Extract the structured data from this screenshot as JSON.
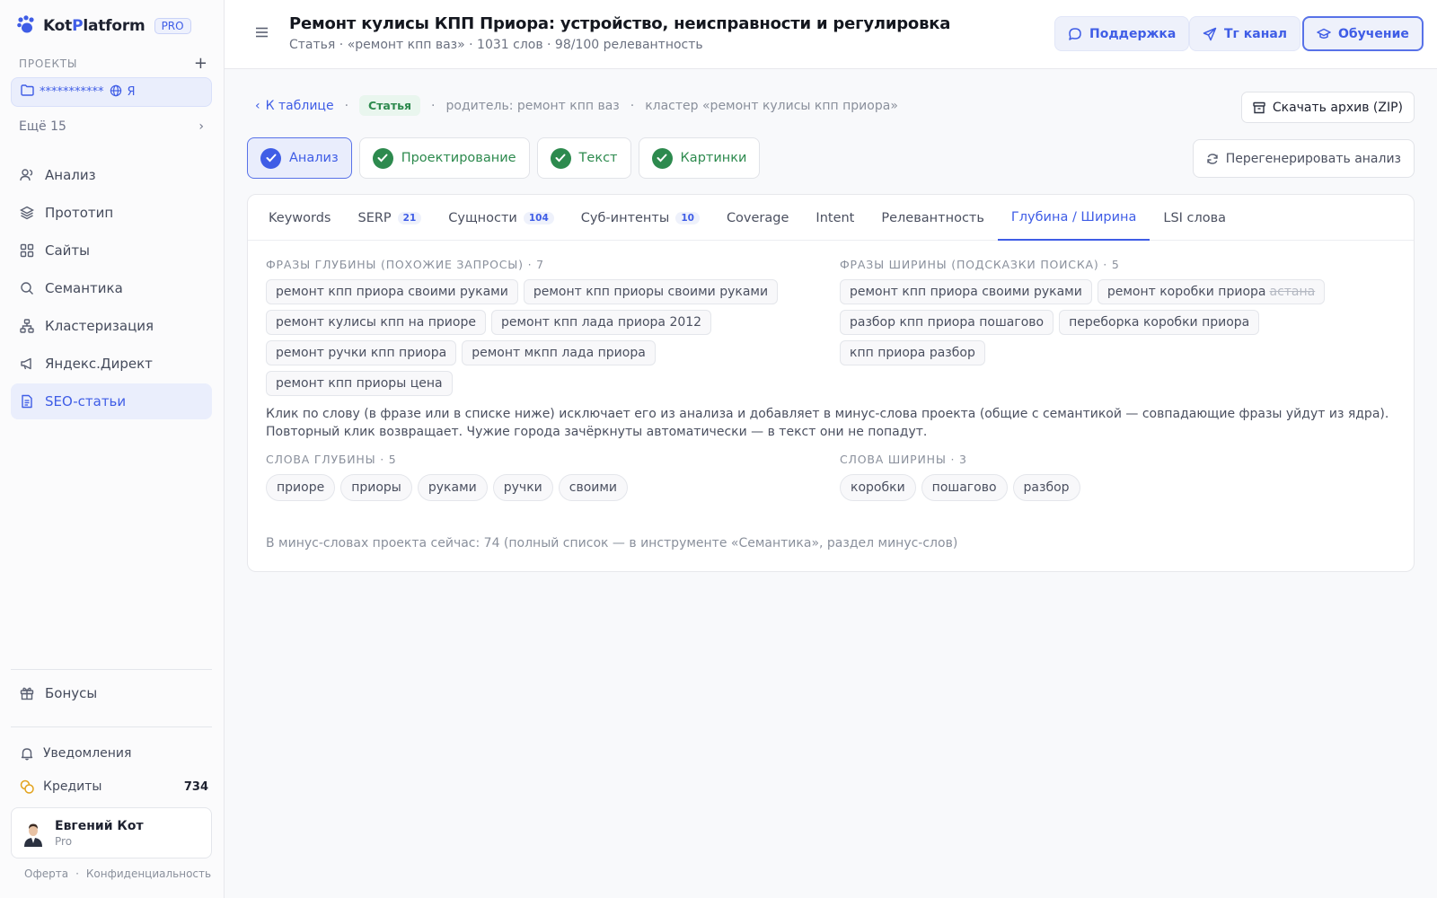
{
  "brand": {
    "name_part1": "Kot",
    "name_part2": "P",
    "name_part3": "latform",
    "badge": "PRO"
  },
  "sidebar": {
    "projects_caption": "ПРОЕКТЫ",
    "project": {
      "name": "***********",
      "suffix": "Я"
    },
    "more_label": "Ещё 15",
    "nav": [
      {
        "label": "Анализ",
        "icon": "users-icon"
      },
      {
        "label": "Прототип",
        "icon": "layers-icon"
      },
      {
        "label": "Сайты",
        "icon": "grid-icon"
      },
      {
        "label": "Семантика",
        "icon": "search-icon"
      },
      {
        "label": "Кластеризация",
        "icon": "cluster-icon"
      },
      {
        "label": "Яндекс.Директ",
        "icon": "megaphone-icon"
      },
      {
        "label": "SEO-статьи",
        "icon": "document-icon",
        "active": true
      }
    ],
    "bonus_label": "Бонусы",
    "notifications_label": "Уведомления",
    "credits_label": "Кредиты",
    "credits_value": "734",
    "user": {
      "name": "Евгений Кот",
      "plan": "Pro"
    },
    "footer": {
      "offer": "Оферта",
      "sep": "·",
      "privacy": "Конфиденциальность"
    }
  },
  "header": {
    "title": "Ремонт кулисы КПП Приора: устройство, неисправности и регулировка",
    "subtitle": "Статья · «ремонт кпп ваз» · 1031 слов · 98/100 релевантность",
    "support_label": "Поддержка",
    "tg_label": "Тг канал",
    "learn_label": "Обучение"
  },
  "crumbs": {
    "back": "К таблице",
    "sep": "·",
    "status": "Статья",
    "parent": "родитель: ремонт кпп ваз",
    "cluster": "кластер «ремонт кулисы кпп приора»",
    "download": "Скачать архив (ZIP)"
  },
  "steps": [
    {
      "label": "Анализ",
      "active": true
    },
    {
      "label": "Проектирование"
    },
    {
      "label": "Текст"
    },
    {
      "label": "Картинки"
    }
  ],
  "regen_label": "Перегенерировать анализ",
  "tabs": [
    {
      "label": "Keywords"
    },
    {
      "label": "SERP",
      "count": "21"
    },
    {
      "label": "Сущности",
      "count": "104"
    },
    {
      "label": "Суб-интенты",
      "count": "10"
    },
    {
      "label": "Coverage"
    },
    {
      "label": "Intent"
    },
    {
      "label": "Релевантность"
    },
    {
      "label": "Глубина / Ширина",
      "active": true
    },
    {
      "label": "LSI слова"
    }
  ],
  "depth_phrases": {
    "caption": "ФРАЗЫ ГЛУБИНЫ (ПОХОЖИЕ ЗАПРОСЫ) · 7",
    "items": [
      "ремонт кпп приора своими руками",
      "ремонт кпп приоры своими руками",
      "ремонт кулисы кпп на приоре",
      "ремонт кпп лада приора 2012",
      "ремонт ручки кпп приора",
      "ремонт мкпп лада приора",
      "ремонт кпп приоры цена"
    ]
  },
  "width_phrases": {
    "caption": "ФРАЗЫ ШИРИНЫ (ПОДСКАЗКИ ПОИСКА) · 5",
    "items": [
      {
        "text": "ремонт кпп приора своими руками"
      },
      {
        "text": "ремонт коробки приора",
        "strike": "астана"
      },
      {
        "text": "разбор кпп приора пошагово"
      },
      {
        "text": "переборка коробки приора"
      },
      {
        "text": "кпп приора разбор"
      }
    ]
  },
  "note": "Клик по слову (в фразе или в списке ниже) исключает его из анализа и добавляет в минус-слова проекта (общие с семантикой — совпадающие фразы уйдут из ядра). Повторный клик возвращает. Чужие города зачёркнуты автоматически — в текст они не попадут.",
  "depth_words": {
    "caption": "СЛОВА ГЛУБИНЫ · 5",
    "items": [
      "приоре",
      "приоры",
      "руками",
      "ручки",
      "своими"
    ]
  },
  "width_words": {
    "caption": "СЛОВА ШИРИНЫ · 3",
    "items": [
      "коробки",
      "пошагово",
      "разбор"
    ]
  },
  "minus_note": "В минус-словах проекта сейчас: 74 (полный список — в инструменте «Семантика», раздел минус-слов)"
}
